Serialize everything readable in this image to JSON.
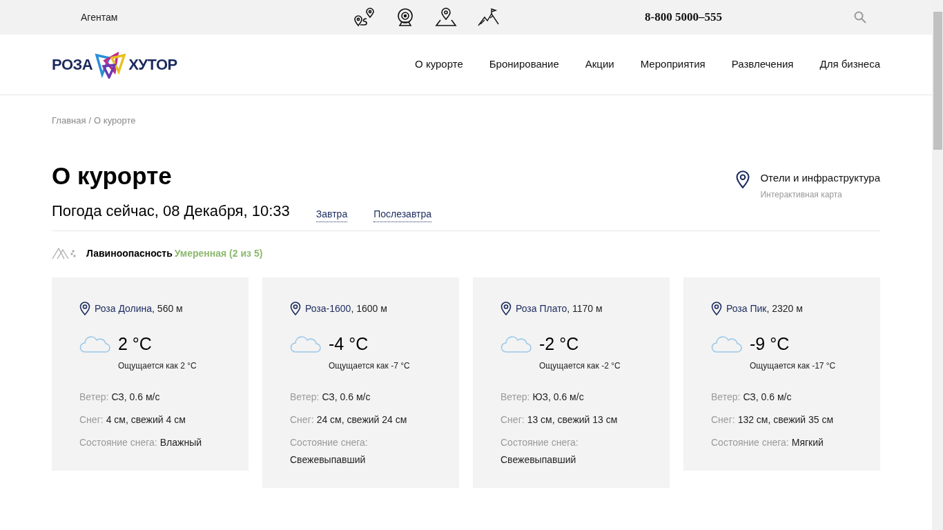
{
  "topbar": {
    "agents_link": "Агентам",
    "phone": "8-800 5000–555"
  },
  "logo": {
    "left": "РОЗА",
    "right": "ХУТОР"
  },
  "nav": [
    "О курорте",
    "Бронирование",
    "Акции",
    "Мероприятия",
    "Развлечения",
    "Для бизнеса"
  ],
  "breadcrumbs": [
    "Главная",
    "О курорте"
  ],
  "breadcrumb_separator": "/",
  "title": "О курорте",
  "map_link": {
    "title": "Отели и инфраструктура",
    "subtitle": "Интерактивная карта"
  },
  "weather": {
    "heading": "Погода сейчас, 08 Декабря, 10:33",
    "tabs": [
      "Завтра",
      "Послезавтра"
    ]
  },
  "avalanche": {
    "label": "Лавиноопасность",
    "value": "Умеренная (2 из 5)"
  },
  "stations": [
    {
      "name": "Роза Долина",
      "altitude": ", 560 м",
      "temp": "2 °C",
      "feels": "Ощущается как 2 °C",
      "wind_label": "Ветер:",
      "wind": "СЗ, 0.6 м/с",
      "snow_label": "Снег:",
      "snow": "4 см, свежий 4 см",
      "state_label": "Состояние снега:",
      "state": "Влажный"
    },
    {
      "name": "Роза-1600",
      "altitude": ", 1600 м",
      "temp": "-4 °C",
      "feels": "Ощущается как -7 °C",
      "wind_label": "Ветер:",
      "wind": "СЗ, 0.6 м/с",
      "snow_label": "Снег:",
      "snow": "24 см, свежий 24 см",
      "state_label": "Состояние снега:",
      "state": "Свежевыпавший"
    },
    {
      "name": "Роза Плато",
      "altitude": ", 1170 м",
      "temp": "-2 °C",
      "feels": "Ощущается как -2 °C",
      "wind_label": "Ветер:",
      "wind": "ЮЗ, 0.6 м/с",
      "snow_label": "Снег:",
      "snow": "13 см, свежий 13 см",
      "state_label": "Состояние снега:",
      "state": "Свежевыпавший"
    },
    {
      "name": "Роза Пик",
      "altitude": ", 2320 м",
      "temp": "-9 °C",
      "feels": "Ощущается как -17 °C",
      "wind_label": "Ветер:",
      "wind": "СЗ, 0.6 м/с",
      "snow_label": "Снег:",
      "snow": "132 см, свежий 35 см",
      "state_label": "Состояние снега:",
      "state": "Мягкий"
    }
  ]
}
